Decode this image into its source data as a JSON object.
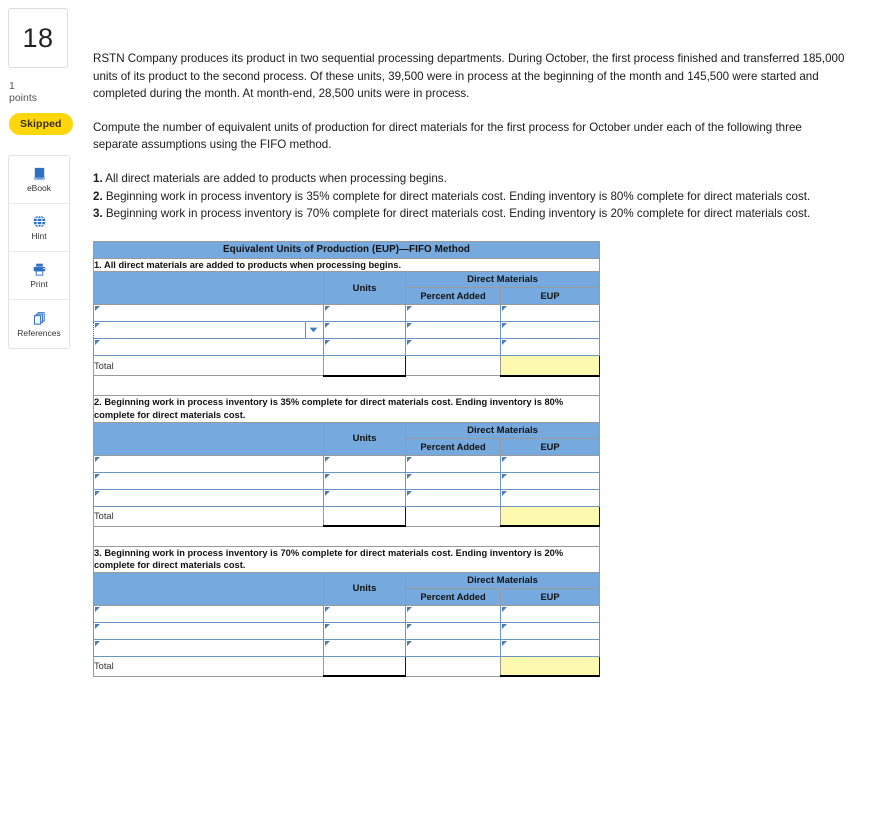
{
  "question": {
    "number": "18",
    "points_value": "1",
    "points_label": "points",
    "status_badge": "Skipped"
  },
  "tools": [
    {
      "name": "ebook",
      "label": "eBook",
      "icon": "book-icon"
    },
    {
      "name": "hint",
      "label": "Hint",
      "icon": "globe-icon"
    },
    {
      "name": "print",
      "label": "Print",
      "icon": "printer-icon"
    },
    {
      "name": "references",
      "label": "References",
      "icon": "copy-pages-icon"
    }
  ],
  "prompt": {
    "paragraph1": "RSTN Company produces its product in two sequential processing departments. During October, the first process finished and transferred 185,000 units of its product to the second process. Of these units, 39,500 were in process at the beginning of the month and 145,500 were started and completed during the month. At month-end, 28,500 units were in process.",
    "paragraph2": "Compute the number of equivalent units of production for direct materials for the first process for October under each of the following three separate assumptions using the FIFO method.",
    "assumptions": [
      {
        "marker": "1.",
        "text": "All direct materials are added to products when processing begins."
      },
      {
        "marker": "2.",
        "text": "Beginning work in process inventory is 35% complete for direct materials cost. Ending inventory is 80% complete for direct materials cost."
      },
      {
        "marker": "3.",
        "text": "Beginning work in process inventory is 70% complete for direct materials cost. Ending inventory is 20% complete for direct materials cost."
      }
    ]
  },
  "table": {
    "title": "Equivalent Units of Production (EUP)—FIFO Method",
    "headers": {
      "blank": "",
      "units": "Units",
      "direct_materials": "Direct Materials",
      "percent_added": "Percent Added",
      "eup": "EUP"
    },
    "total_label": "Total",
    "sections": [
      {
        "id": "section-1",
        "assumption": "1. All direct materials are added to products when processing begins.",
        "rows": [
          {
            "label": "",
            "units": "",
            "percent_added": "",
            "eup": "",
            "focused": false,
            "dropdown": false
          },
          {
            "label": "",
            "units": "",
            "percent_added": "",
            "eup": "",
            "focused": true,
            "dropdown": true
          },
          {
            "label": "",
            "units": "",
            "percent_added": "",
            "eup": "",
            "focused": false,
            "dropdown": false
          }
        ],
        "total": {
          "units": "",
          "percent_added": "",
          "eup": ""
        }
      },
      {
        "id": "section-2",
        "assumption": "2. Beginning work in process inventory is 35% complete for direct materials cost. Ending inventory is 80% complete for direct materials cost.",
        "rows": [
          {
            "label": "",
            "units": "",
            "percent_added": "",
            "eup": "",
            "focused": false,
            "dropdown": false
          },
          {
            "label": "",
            "units": "",
            "percent_added": "",
            "eup": "",
            "focused": false,
            "dropdown": false
          },
          {
            "label": "",
            "units": "",
            "percent_added": "",
            "eup": "",
            "focused": false,
            "dropdown": false
          }
        ],
        "total": {
          "units": "",
          "percent_added": "",
          "eup": ""
        }
      },
      {
        "id": "section-3",
        "assumption": "3. Beginning work in process inventory is 70% complete for direct materials cost. Ending inventory is 20% complete for direct materials cost.",
        "rows": [
          {
            "label": "",
            "units": "",
            "percent_added": "",
            "eup": "",
            "focused": false,
            "dropdown": false
          },
          {
            "label": "",
            "units": "",
            "percent_added": "",
            "eup": "",
            "focused": false,
            "dropdown": false
          },
          {
            "label": "",
            "units": "",
            "percent_added": "",
            "eup": "",
            "focused": false,
            "dropdown": false
          }
        ],
        "total": {
          "units": "",
          "percent_added": "",
          "eup": ""
        }
      }
    ]
  },
  "colors": {
    "header_blue": "#76a9dd",
    "badge_yellow": "#ffd60a",
    "answer_yellow": "#fdfab0",
    "icon_blue": "#2f6fc4"
  }
}
